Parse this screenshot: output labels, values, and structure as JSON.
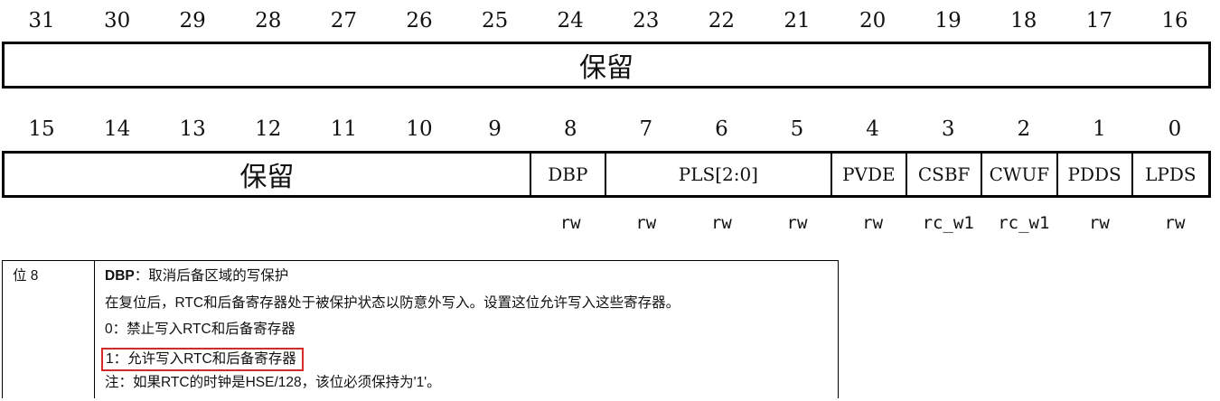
{
  "register": {
    "high_bits": [
      "31",
      "30",
      "29",
      "28",
      "27",
      "26",
      "25",
      "24",
      "23",
      "22",
      "21",
      "20",
      "19",
      "18",
      "17",
      "16"
    ],
    "high_fields": [
      {
        "label": "保留",
        "span": 16,
        "reserved": true
      }
    ],
    "low_bits": [
      "15",
      "14",
      "13",
      "12",
      "11",
      "10",
      "9",
      "8",
      "7",
      "6",
      "5",
      "4",
      "3",
      "2",
      "1",
      "0"
    ],
    "low_fields": [
      {
        "label": "保留",
        "span": 7,
        "reserved": true
      },
      {
        "label": "DBP",
        "span": 1
      },
      {
        "label": "PLS[2:0]",
        "span": 3
      },
      {
        "label": "PVDE",
        "span": 1
      },
      {
        "label": "CSBF",
        "span": 1
      },
      {
        "label": "CWUF",
        "span": 1
      },
      {
        "label": "PDDS",
        "span": 1
      },
      {
        "label": "LPDS",
        "span": 1
      }
    ],
    "access": [
      "",
      "",
      "",
      "",
      "",
      "",
      "",
      "rw",
      "rw",
      "rw",
      "rw",
      "rw",
      "rc_w1",
      "rc_w1",
      "rw",
      "rw"
    ]
  },
  "description": {
    "bit_label": "位 8",
    "title_bold": "DBP",
    "title_rest": "：取消后备区域的写保护",
    "line1": "在复位后，RTC和后备寄存器处于被保护状态以防意外写入。设置这位允许写入这些寄存器。",
    "line2": "0：禁止写入RTC和后备寄存器",
    "line3_highlighted": "1：允许写入RTC和后备寄存器",
    "note": "注：如果RTC的时钟是HSE/128，该位必须保持为'1'。",
    "highlight_color": "#d62a2a"
  }
}
